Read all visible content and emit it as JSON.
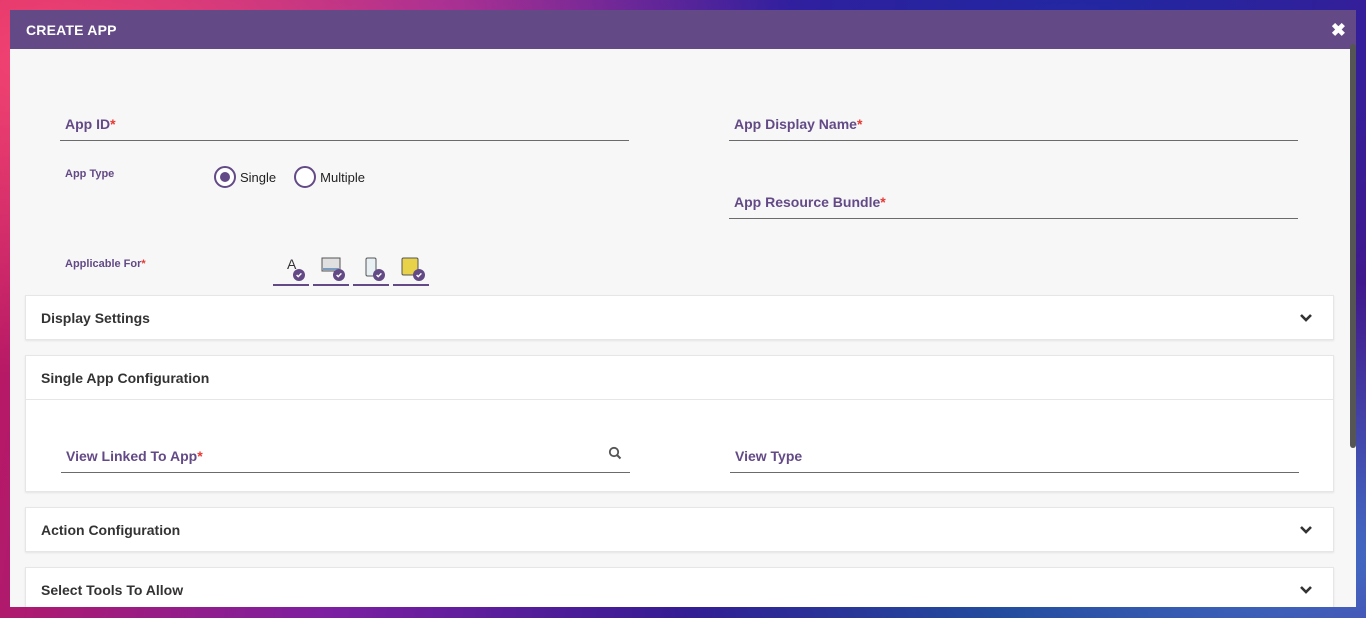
{
  "modal": {
    "title": "CREATE APP",
    "close_icon": "close-icon"
  },
  "form": {
    "app_id_label": "App ID",
    "app_display_name_label": "App Display Name",
    "app_type_label": "App Type",
    "app_type_options": [
      {
        "label": "Single",
        "selected": true
      },
      {
        "label": "Multiple",
        "selected": false
      }
    ],
    "app_resource_bundle_label": "App Resource Bundle",
    "applicable_for_label": "Applicable For",
    "required_marker": "*",
    "platforms": [
      {
        "icon": "text-a-icon",
        "checked": true
      },
      {
        "icon": "desktop-icon",
        "checked": true
      },
      {
        "icon": "mobile-icon",
        "checked": true
      },
      {
        "icon": "tablet-icon",
        "checked": true
      }
    ]
  },
  "sections": {
    "display_settings": "Display Settings",
    "single_app_configuration": "Single App Configuration",
    "view_linked_to_app_label": "View Linked To App",
    "view_type_label": "View Type",
    "action_configuration": "Action Configuration",
    "select_tools_to_allow": "Select Tools To Allow"
  },
  "colors": {
    "header_bg": "#634a87",
    "label_color": "#634a87",
    "required_color": "#e53935"
  }
}
